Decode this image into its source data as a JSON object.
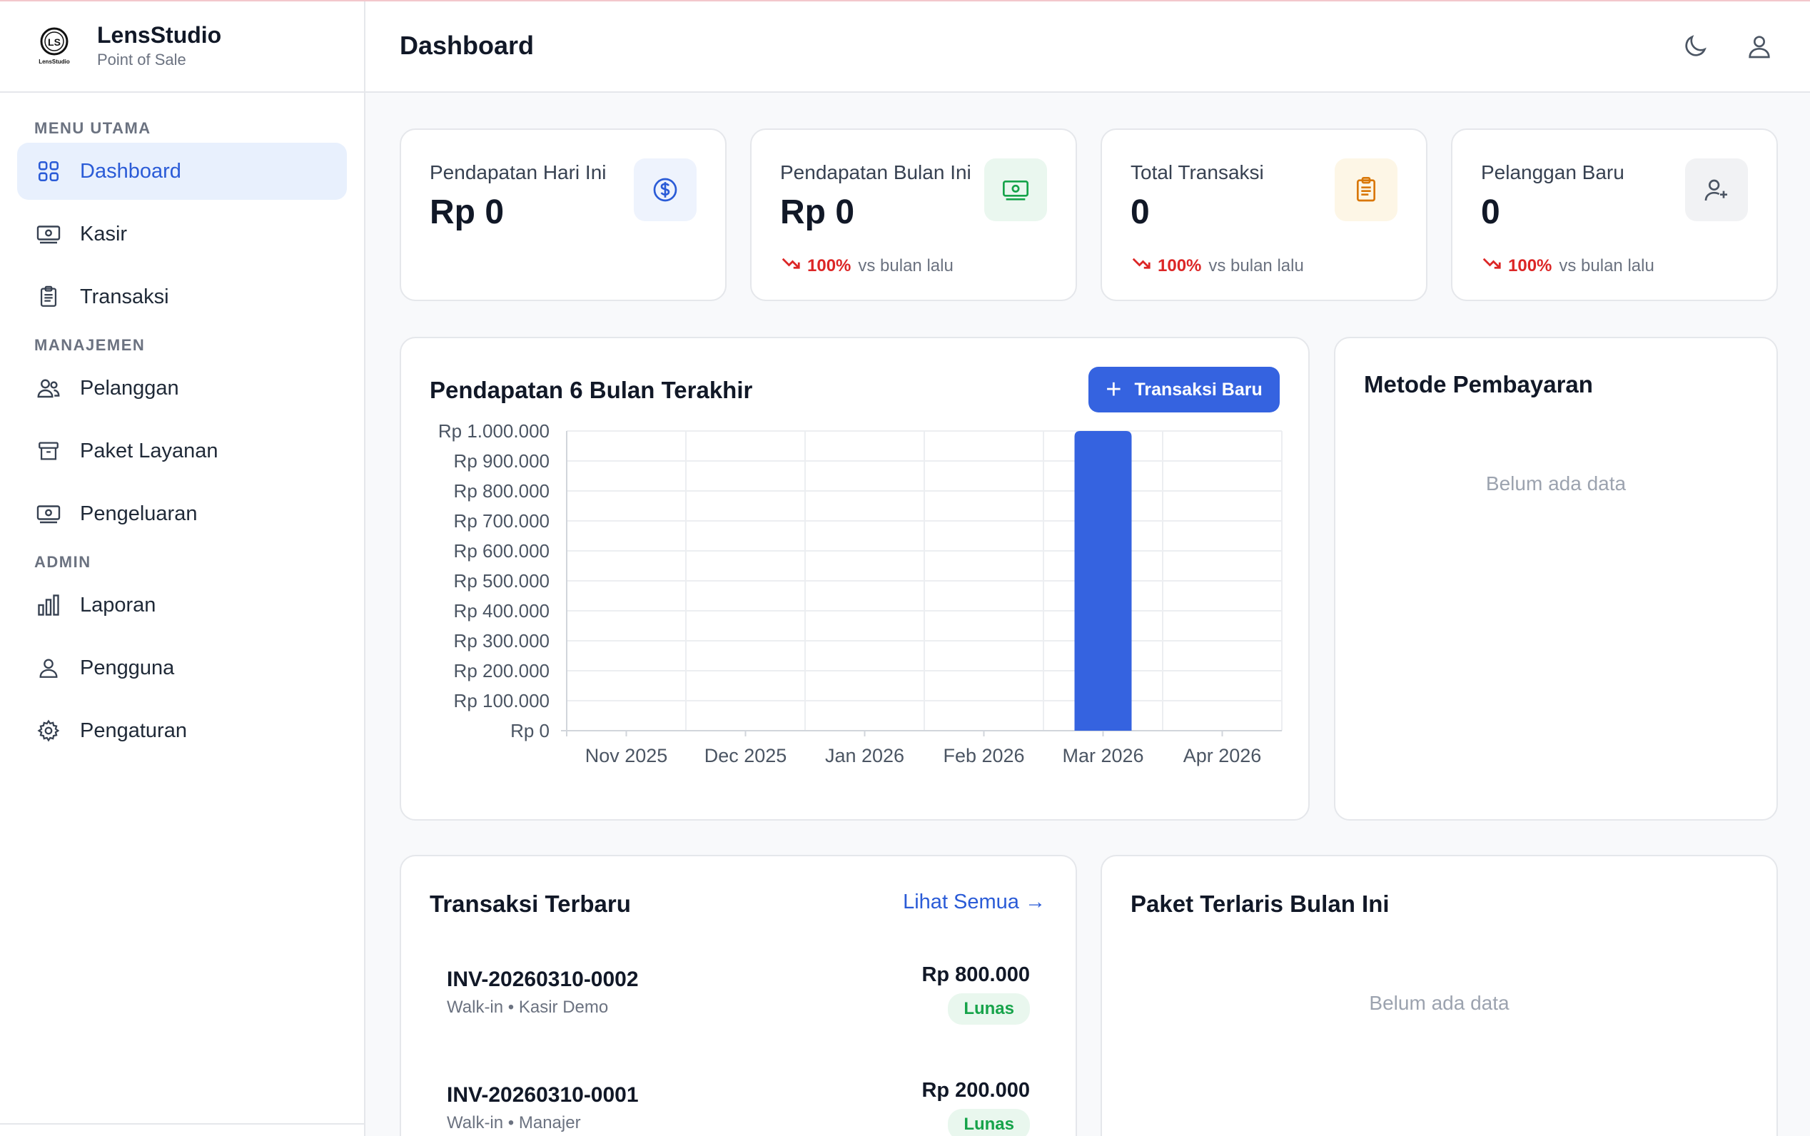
{
  "brand": {
    "title": "LensStudio",
    "subtitle": "Point of Sale",
    "logo_text": "LS",
    "logo_caption": "LensStudio"
  },
  "sidebar": {
    "sections": [
      {
        "label": "MENU UTAMA",
        "items": [
          {
            "label": "Dashboard",
            "icon": "grid-icon",
            "active": true
          },
          {
            "label": "Kasir",
            "icon": "cash-icon"
          },
          {
            "label": "Transaksi",
            "icon": "clipboard-icon"
          }
        ]
      },
      {
        "label": "MANAJEMEN",
        "items": [
          {
            "label": "Pelanggan",
            "icon": "users-icon"
          },
          {
            "label": "Paket Layanan",
            "icon": "archive-icon"
          },
          {
            "label": "Pengeluaran",
            "icon": "cash-icon"
          }
        ]
      },
      {
        "label": "ADMIN",
        "items": [
          {
            "label": "Laporan",
            "icon": "bar-chart-icon"
          },
          {
            "label": "Pengguna",
            "icon": "user-icon"
          },
          {
            "label": "Pengaturan",
            "icon": "gear-icon"
          }
        ]
      }
    ]
  },
  "header": {
    "title": "Dashboard",
    "icons": [
      "moon-icon",
      "user-icon"
    ]
  },
  "stats": [
    {
      "label": "Pendapatan Hari Ini",
      "value": "Rp 0",
      "icon": "dollar-icon",
      "icon_bg": "#eef3fd",
      "icon_color": "#2a5bd7"
    },
    {
      "label": "Pendapatan Bulan Ini",
      "value": "Rp 0",
      "icon": "cash-icon",
      "icon_bg": "#eaf7ef",
      "icon_color": "#16a34a",
      "change": "100%",
      "change_text": "vs bulan lalu"
    },
    {
      "label": "Total Transaksi",
      "value": "0",
      "icon": "clipboard-icon",
      "icon_bg": "#fdf6e6",
      "icon_color": "#d97706",
      "change": "100%",
      "change_text": "vs bulan lalu"
    },
    {
      "label": "Pelanggan Baru",
      "value": "0",
      "icon": "user-plus-icon",
      "icon_bg": "#f1f2f4",
      "icon_color": "#4b5563",
      "change": "100%",
      "change_text": "vs bulan lalu"
    }
  ],
  "revenue_card": {
    "title": "Pendapatan 6 Bulan Terakhir",
    "button_label": "Transaksi Baru"
  },
  "chart_data": {
    "type": "bar",
    "categories": [
      "Nov 2025",
      "Dec 2025",
      "Jan 2026",
      "Feb 2026",
      "Mar 2026",
      "Apr 2026"
    ],
    "values": [
      0,
      0,
      0,
      0,
      1000000,
      0
    ],
    "ylim": [
      0,
      1000000
    ],
    "yticks": [
      "Rp 0",
      "Rp 100.000",
      "Rp 200.000",
      "Rp 300.000",
      "Rp 400.000",
      "Rp 500.000",
      "Rp 600.000",
      "Rp 700.000",
      "Rp 800.000",
      "Rp 900.000",
      "Rp 1.000.000"
    ],
    "bar_color": "#3563e0",
    "grid": true
  },
  "payment_card": {
    "title": "Metode Pembayaran",
    "empty": "Belum ada data"
  },
  "recent_tx": {
    "title": "Transaksi Terbaru",
    "link": "Lihat Semua →",
    "items": [
      {
        "invoice": "INV-20260310-0002",
        "sub": "Walk-in • Kasir Demo",
        "amount": "Rp 800.000",
        "status": "Lunas"
      },
      {
        "invoice": "INV-20260310-0001",
        "sub": "Walk-in • Manajer",
        "amount": "Rp 200.000",
        "status": "Lunas"
      }
    ]
  },
  "top_packages": {
    "title": "Paket Terlaris Bulan Ini",
    "empty": "Belum ada data"
  }
}
